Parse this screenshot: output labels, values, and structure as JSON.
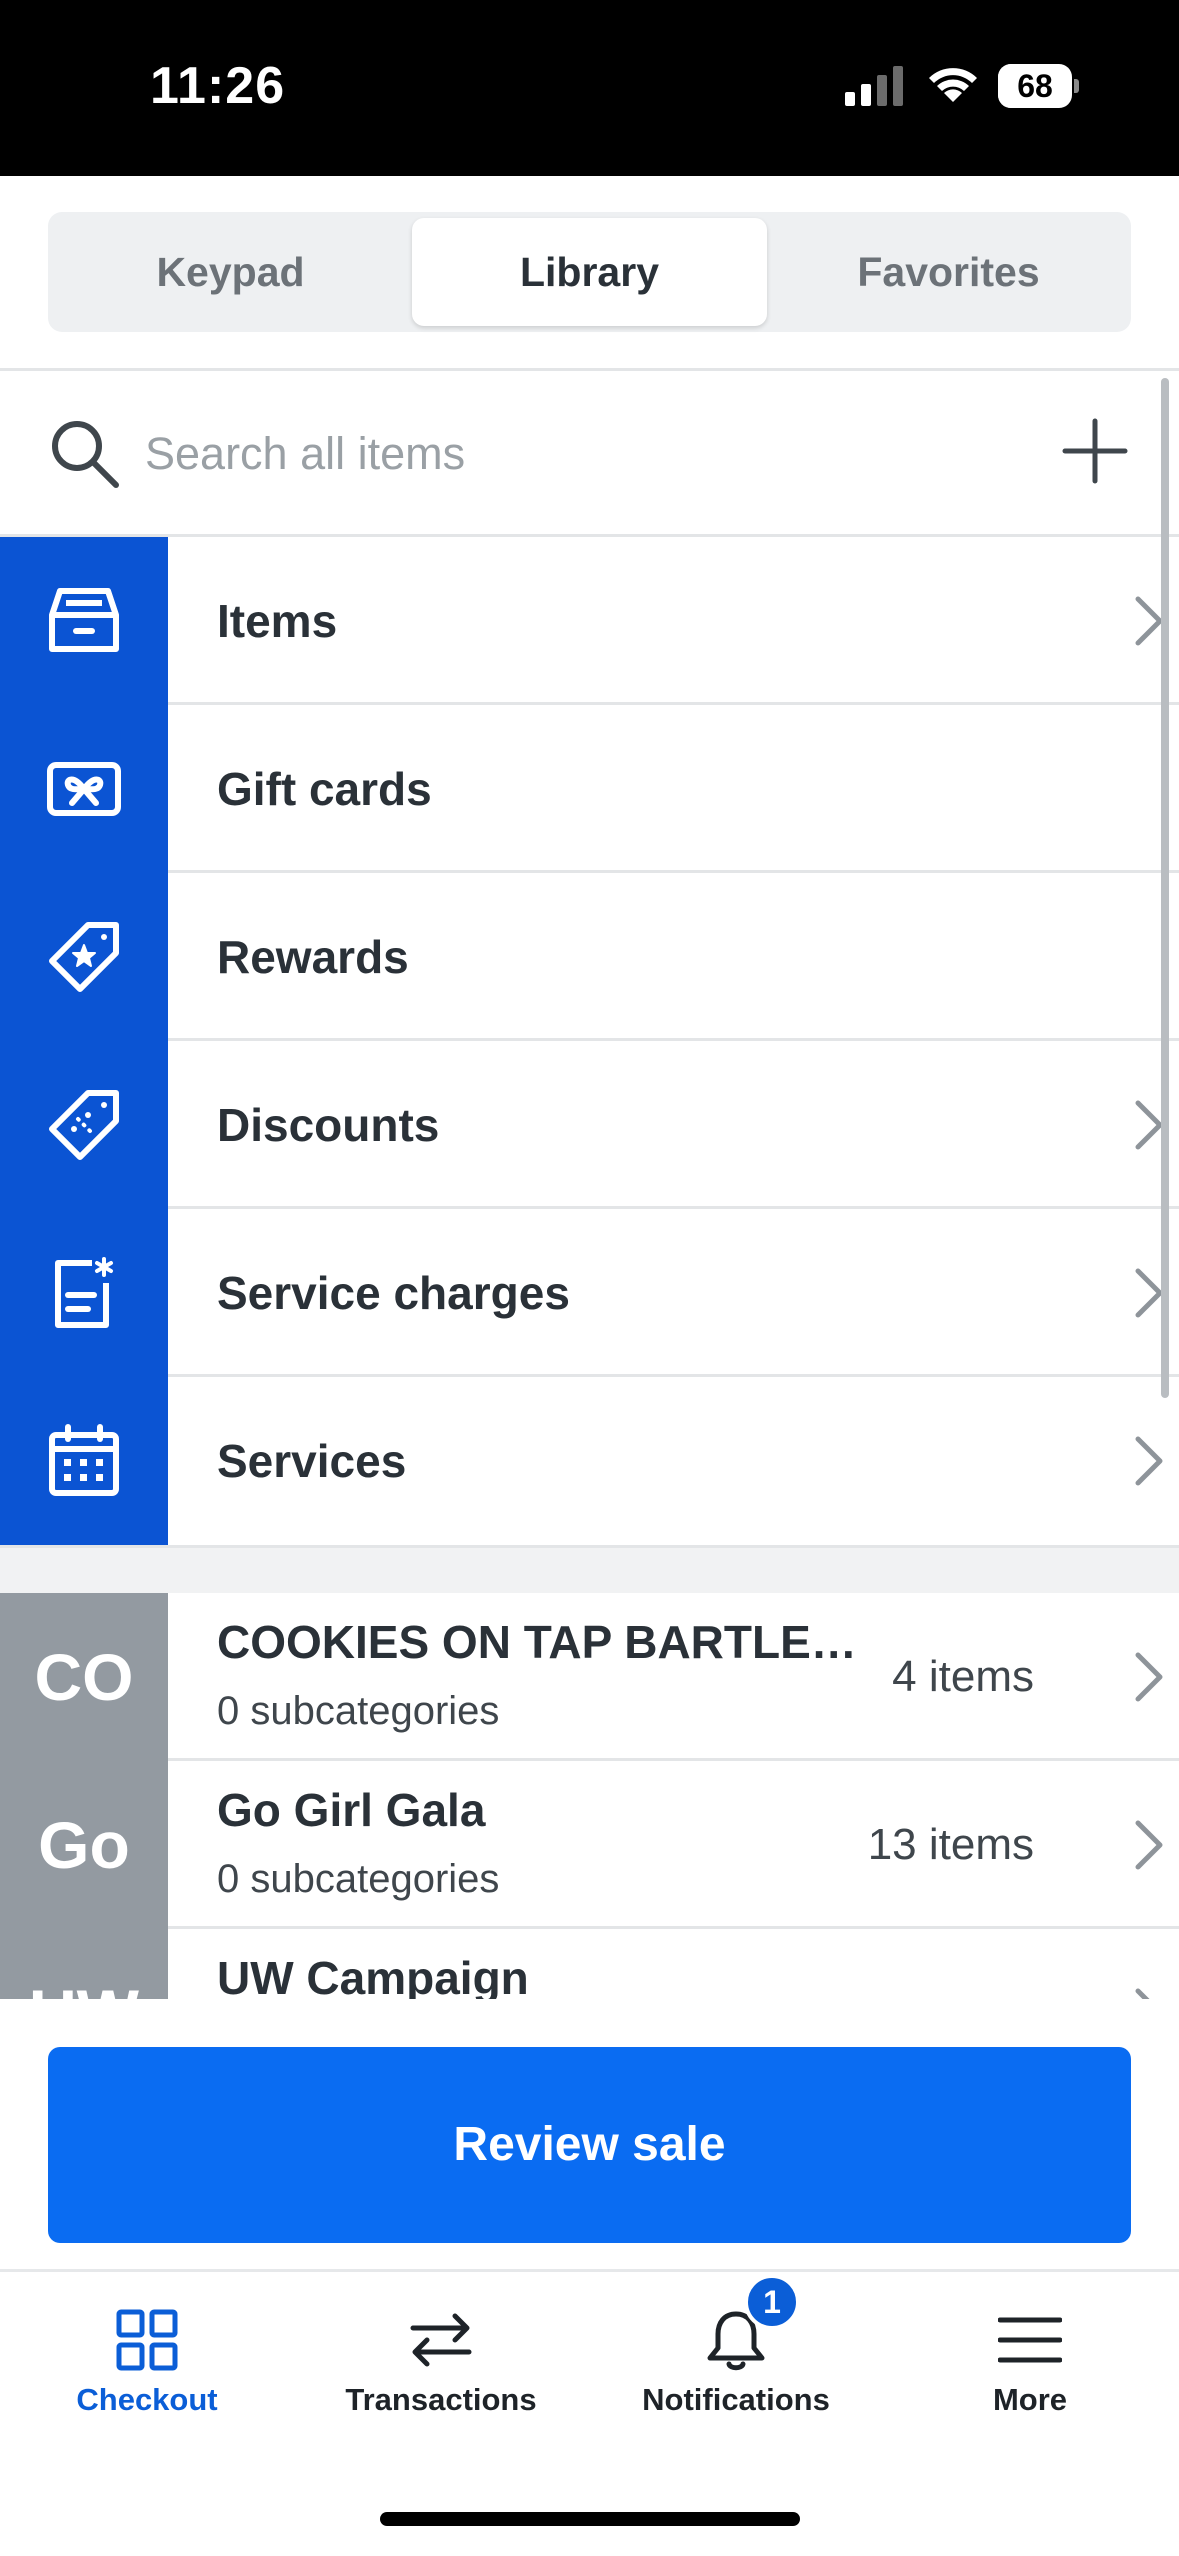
{
  "status_bar": {
    "time": "11:26",
    "battery_percent": "68",
    "battery_level": 0.68
  },
  "segmented": {
    "tabs": [
      "Keypad",
      "Library",
      "Favorites"
    ],
    "selected": "Library"
  },
  "search": {
    "placeholder": "Search all items",
    "value": "",
    "icon": "search-icon",
    "add_icon": "plus-icon"
  },
  "library": {
    "items": [
      {
        "label": "Items",
        "icon": "inventory-tray-icon",
        "has_chevron": true
      },
      {
        "label": "Gift cards",
        "icon": "gift-card-icon",
        "has_chevron": false
      },
      {
        "label": "Rewards",
        "icon": "reward-tag-icon",
        "has_chevron": false
      },
      {
        "label": "Discounts",
        "icon": "discount-tag-icon",
        "has_chevron": true
      },
      {
        "label": "Service charges",
        "icon": "service-charge-icon",
        "has_chevron": true
      },
      {
        "label": "Services",
        "icon": "calendar-icon",
        "has_chevron": true
      }
    ]
  },
  "categories": [
    {
      "abbr": "CO",
      "name": "COOKIES ON TAP BARTLE…",
      "subtitle": "0 subcategories",
      "count": "4 items"
    },
    {
      "abbr": "Go",
      "name": "Go Girl Gala",
      "subtitle": "0 subcategories",
      "count": "13 items"
    },
    {
      "abbr": "UW",
      "name": "UW Campaign",
      "subtitle": "",
      "count": ""
    }
  ],
  "review_button": "Review sale",
  "tabbar": {
    "tabs": [
      {
        "label": "Checkout",
        "icon": "grid-icon",
        "active": true
      },
      {
        "label": "Transactions",
        "icon": "arrows-swap-icon",
        "active": false
      },
      {
        "label": "Notifications",
        "icon": "bell-icon",
        "active": false,
        "badge": "1"
      },
      {
        "label": "More",
        "icon": "menu-icon",
        "active": false
      }
    ]
  },
  "colors": {
    "brand_blue": "#0b54d3",
    "button_blue": "#0a6cf2",
    "category_gray": "#939aa1",
    "active_tab": "#0b5ed7"
  }
}
